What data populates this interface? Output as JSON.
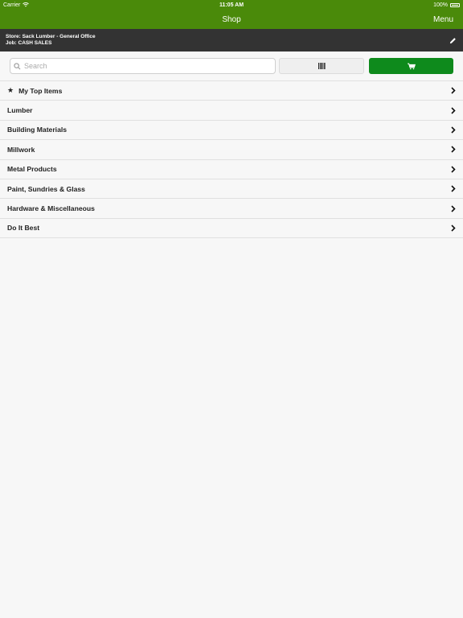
{
  "status_bar": {
    "carrier": "Carrier",
    "time": "11:05 AM",
    "battery": "100%"
  },
  "nav": {
    "title": "Shop",
    "menu_label": "Menu"
  },
  "store_bar": {
    "store": "Store: Sack Lumber - General Office",
    "job": "Job: CASH SALES"
  },
  "search": {
    "placeholder": "Search"
  },
  "categories": [
    {
      "label": "My Top Items",
      "icon": "star-icon"
    },
    {
      "label": "Lumber"
    },
    {
      "label": "Building Materials"
    },
    {
      "label": "Millwork"
    },
    {
      "label": "Metal Products"
    },
    {
      "label": "Paint, Sundries & Glass"
    },
    {
      "label": "Hardware & Miscellaneous"
    },
    {
      "label": "Do It Best"
    }
  ],
  "colors": {
    "nav_green": "#4a8a0a",
    "cart_green": "#0e8a1c",
    "store_bar": "#333333"
  }
}
